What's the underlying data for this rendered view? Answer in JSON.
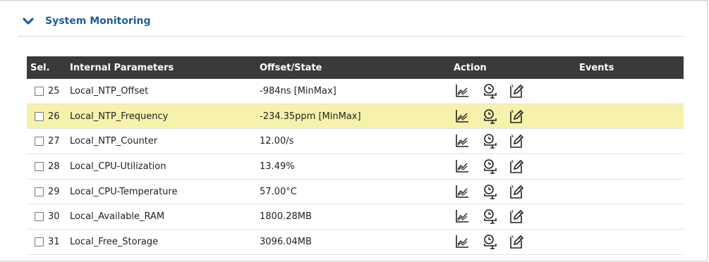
{
  "section": {
    "title": "System Monitoring"
  },
  "table": {
    "headers": {
      "sel": "Sel.",
      "param": "Internal Parameters",
      "offset": "Offset/State",
      "action": "Action",
      "events": "Events"
    },
    "rows": [
      {
        "num": "25",
        "param": "Local_NTP_Offset",
        "value": "-984ns [MinMax]",
        "highlighted": false
      },
      {
        "num": "26",
        "param": "Local_NTP_Frequency",
        "value": "-234.35ppm [MinMax]",
        "highlighted": true
      },
      {
        "num": "27",
        "param": "Local_NTP_Counter",
        "value": "12.00/s",
        "highlighted": false
      },
      {
        "num": "28",
        "param": "Local_CPU-Utilization",
        "value": "13.49%",
        "highlighted": false
      },
      {
        "num": "29",
        "param": "Local_CPU-Temperature",
        "value": "57.00°C",
        "highlighted": false
      },
      {
        "num": "30",
        "param": "Local_Available_RAM",
        "value": "1800.28MB",
        "highlighted": false
      },
      {
        "num": "31",
        "param": "Local_Free_Storage",
        "value": "3096.04MB",
        "highlighted": false
      }
    ]
  },
  "icons": {
    "chevron": "chevron-down-icon",
    "graph": "chart-icon",
    "timer": "timer-icon",
    "edit": "edit-icon"
  },
  "colors": {
    "accent": "#1f5d9c",
    "header_bg": "#3a3a3a",
    "highlight": "#f6f2ab"
  }
}
